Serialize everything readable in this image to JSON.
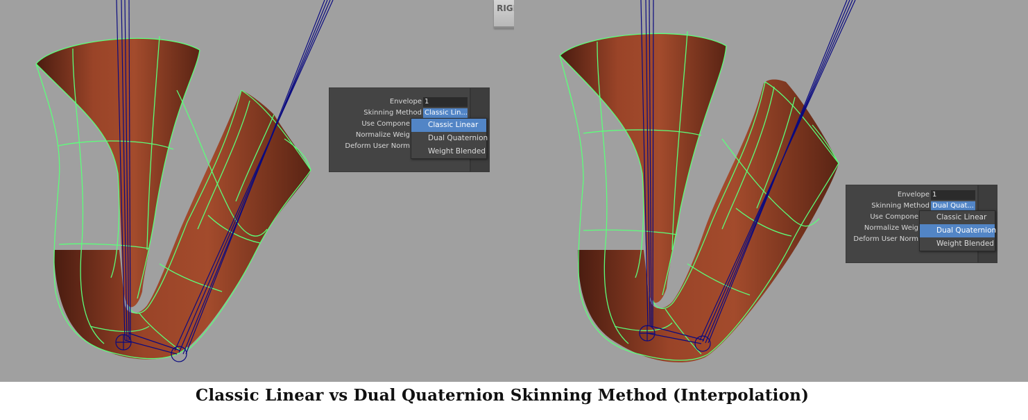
{
  "viewport_label": "RIGHT",
  "caption": "Classic Linear vs Dual Quaternion Skinning Method (Interpolation)",
  "attributes": {
    "envelope_label": "Envelope",
    "envelope_value": "1",
    "skinning_method_label": "Skinning Method",
    "use_components_label": "Use Compone",
    "normalize_weights_label": "Normalize Weig",
    "deform_user_normals_label": "Deform User Norm"
  },
  "panels": [
    {
      "selected_value": "Classic Lin...",
      "highlighted_option": "Classic Linear"
    },
    {
      "selected_value": "Dual Quat...",
      "highlighted_option": "Dual Quaternion"
    }
  ],
  "skinning_options": [
    "Classic Linear",
    "Dual Quaternion",
    "Weight Blended"
  ],
  "colors": {
    "viewport_bg": "#a0a0a0",
    "mesh_wire": "#5cff7a",
    "joint_lines": "#0a0a80",
    "highlight": "#5285c6",
    "mesh_skin": "#8a3a22"
  }
}
